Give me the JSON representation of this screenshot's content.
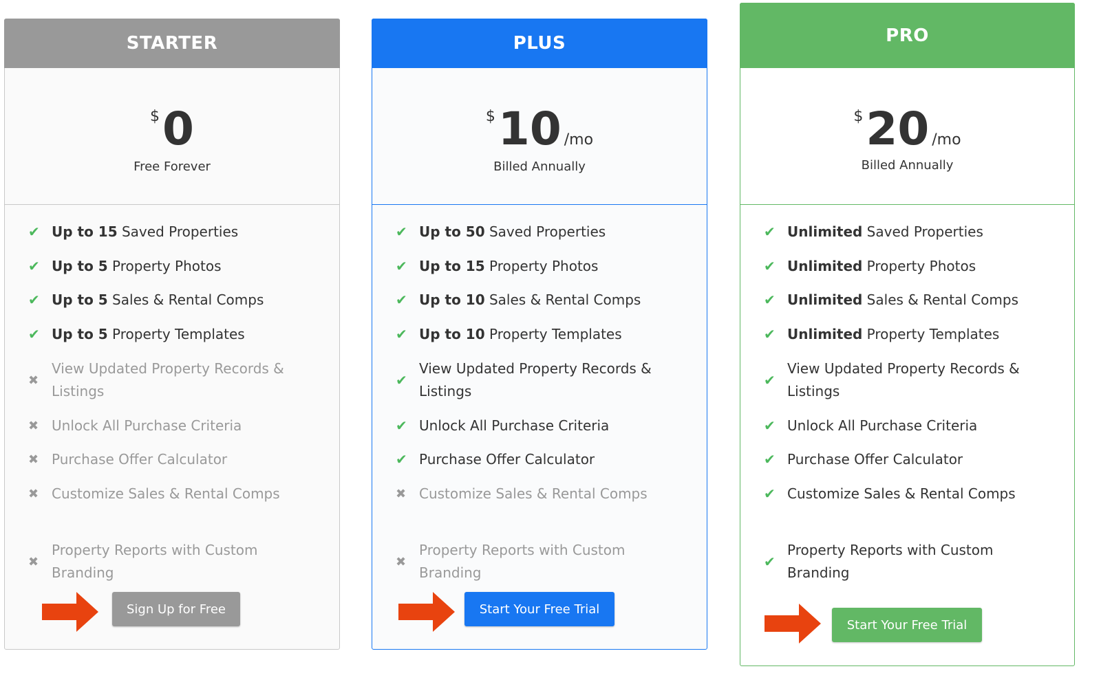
{
  "colors": {
    "starter": "#999999",
    "plus": "#1877f2",
    "pro": "#62b865",
    "check": "#4cb85c",
    "cross": "#999999",
    "arrow": "#e8430f"
  },
  "plans": [
    {
      "name": "STARTER",
      "currency": "$",
      "amount": "0",
      "period": "",
      "subtitle": "Free Forever",
      "button": "Sign Up for Free",
      "features": [
        {
          "bold": "Up to 15",
          "text": " Saved Properties",
          "included": true
        },
        {
          "bold": "Up to 5",
          "text": " Property Photos",
          "included": true
        },
        {
          "bold": "Up to 5",
          "text": " Sales & Rental Comps",
          "included": true
        },
        {
          "bold": "Up to 5",
          "text": " Property Templates",
          "included": true
        },
        {
          "bold": "",
          "text": "View Updated Property Records & Listings",
          "included": false
        },
        {
          "bold": "",
          "text": "Unlock All Purchase Criteria",
          "included": false
        },
        {
          "bold": "",
          "text": "Purchase Offer Calculator",
          "included": false
        },
        {
          "bold": "",
          "text": "Customize Sales & Rental Comps",
          "included": false
        },
        {
          "bold": "",
          "text": "Property Reports with Custom Branding",
          "included": false
        }
      ]
    },
    {
      "name": "PLUS",
      "currency": "$",
      "amount": "10",
      "period": "/mo",
      "subtitle": "Billed Annually",
      "button": "Start Your Free Trial",
      "features": [
        {
          "bold": "Up to 50",
          "text": " Saved Properties",
          "included": true
        },
        {
          "bold": "Up to 15",
          "text": " Property Photos",
          "included": true
        },
        {
          "bold": "Up to 10",
          "text": " Sales & Rental Comps",
          "included": true
        },
        {
          "bold": "Up to 10",
          "text": " Property Templates",
          "included": true
        },
        {
          "bold": "",
          "text": "View Updated Property Records & Listings",
          "included": true
        },
        {
          "bold": "",
          "text": "Unlock All Purchase Criteria",
          "included": true
        },
        {
          "bold": "",
          "text": "Purchase Offer Calculator",
          "included": true
        },
        {
          "bold": "",
          "text": "Customize Sales & Rental Comps",
          "included": false
        },
        {
          "bold": "",
          "text": "Property Reports with Custom Branding",
          "included": false
        }
      ]
    },
    {
      "name": "PRO",
      "currency": "$",
      "amount": "20",
      "period": "/mo",
      "subtitle": "Billed Annually",
      "button": "Start Your Free Trial",
      "features": [
        {
          "bold": "Unlimited",
          "text": " Saved Properties",
          "included": true
        },
        {
          "bold": "Unlimited",
          "text": " Property Photos",
          "included": true
        },
        {
          "bold": "Unlimited",
          "text": " Sales & Rental Comps",
          "included": true
        },
        {
          "bold": "Unlimited",
          "text": " Property Templates",
          "included": true
        },
        {
          "bold": "",
          "text": "View Updated Property Records & Listings",
          "included": true
        },
        {
          "bold": "",
          "text": "Unlock All Purchase Criteria",
          "included": true
        },
        {
          "bold": "",
          "text": "Purchase Offer Calculator",
          "included": true
        },
        {
          "bold": "",
          "text": "Customize Sales & Rental Comps",
          "included": true
        },
        {
          "bold": "",
          "text": "Property Reports with Custom Branding",
          "included": true
        }
      ]
    }
  ],
  "icons": {
    "check": "✔",
    "cross": "✖"
  }
}
